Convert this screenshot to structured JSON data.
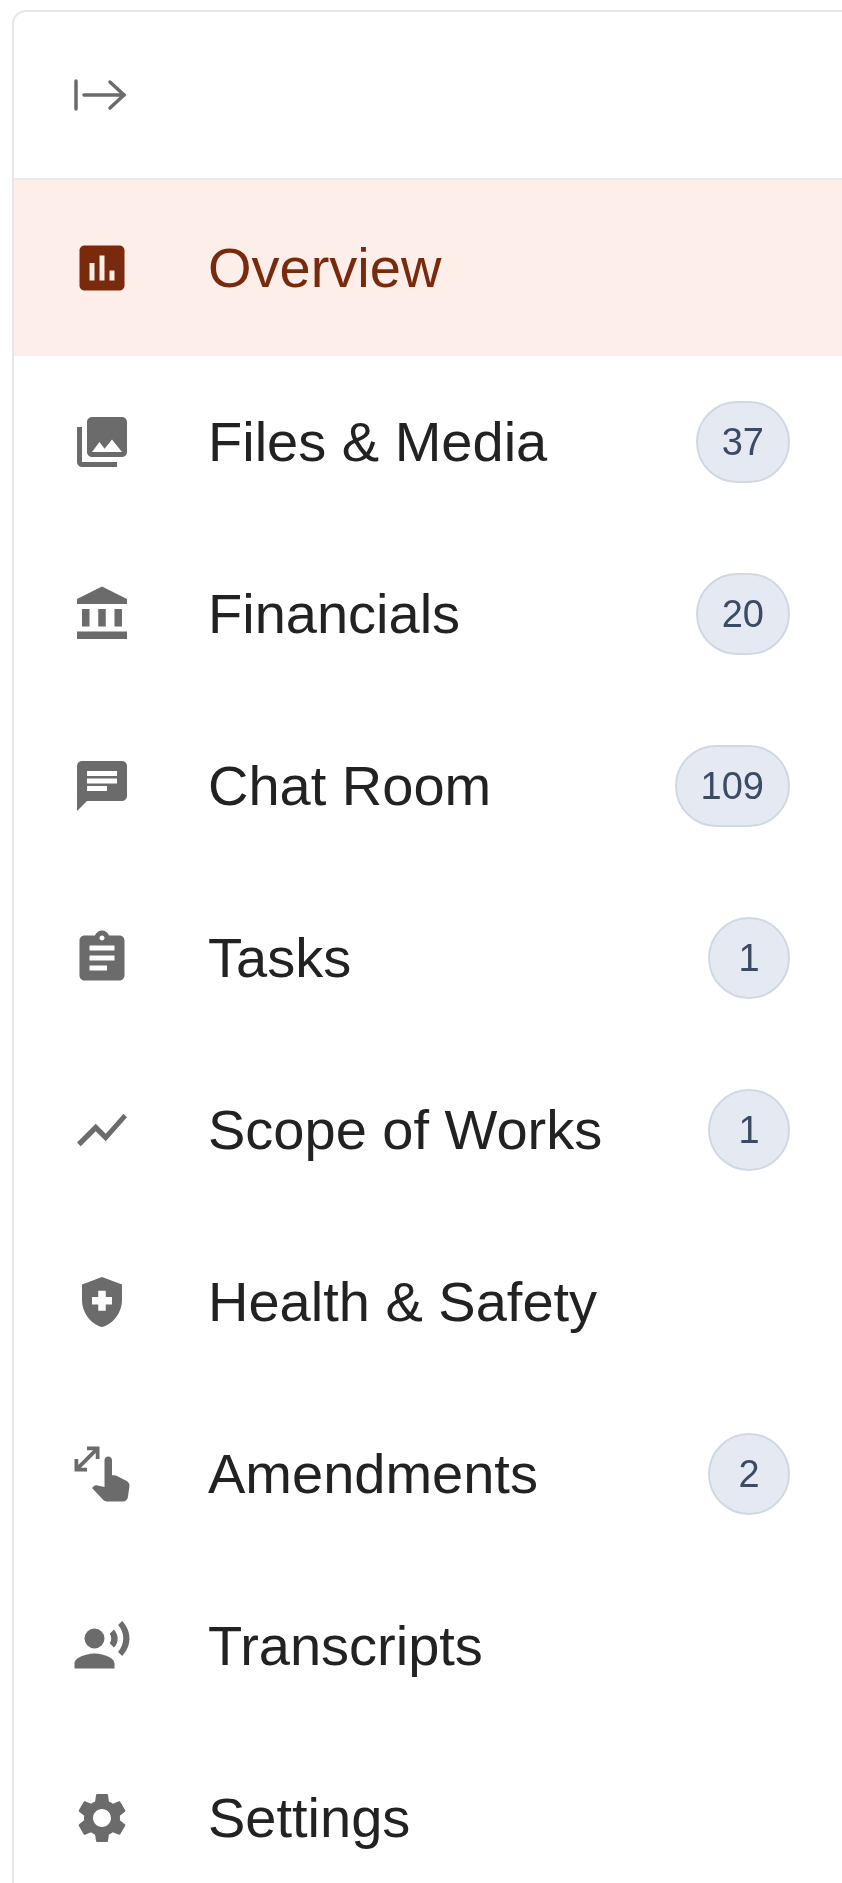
{
  "sidebar": {
    "items": [
      {
        "kind": "overview",
        "label": "Overview",
        "selected": true
      },
      {
        "kind": "media",
        "label": "Files & Media",
        "badge": "37",
        "selected": false
      },
      {
        "kind": "bank",
        "label": "Financials",
        "badge": "20",
        "selected": false
      },
      {
        "kind": "chat",
        "label": "Chat Room",
        "badge": "109",
        "selected": false
      },
      {
        "kind": "clipboard",
        "label": "Tasks",
        "badge": "1",
        "selected": false
      },
      {
        "kind": "chart",
        "label": "Scope of Works",
        "badge": "1",
        "selected": false
      },
      {
        "kind": "shield",
        "label": "Health & Safety",
        "selected": false
      },
      {
        "kind": "pinch",
        "label": "Amendments",
        "badge": "2",
        "selected": false
      },
      {
        "kind": "voice",
        "label": "Transcripts",
        "selected": false
      },
      {
        "kind": "gear",
        "label": "Settings",
        "selected": false
      }
    ]
  }
}
